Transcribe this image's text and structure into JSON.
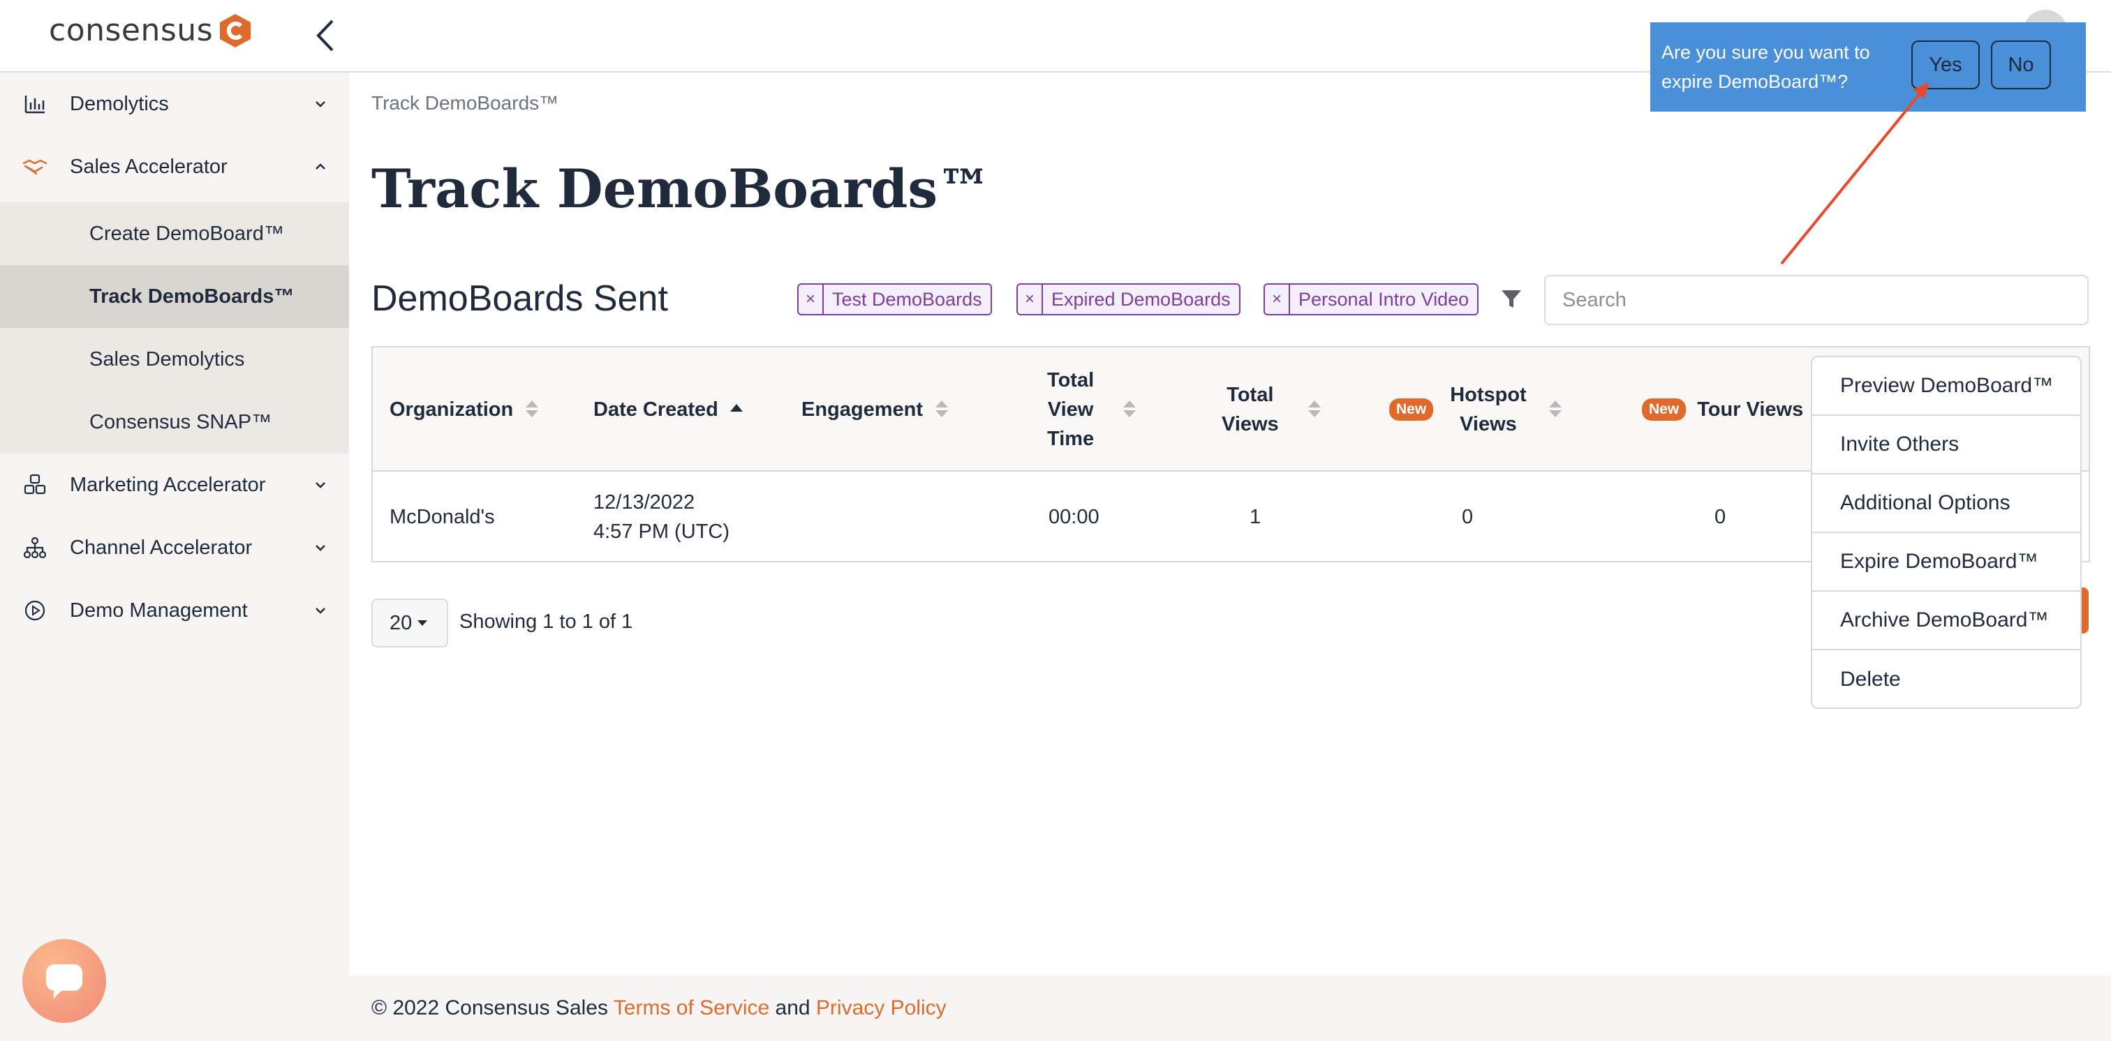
{
  "app": {
    "logo_text": "consensus",
    "brand_color": "#e06a2c"
  },
  "sidebar": {
    "items": [
      {
        "label": "Demolytics",
        "icon": "bar-chart-icon"
      },
      {
        "label": "Sales Accelerator",
        "icon": "handshake-icon"
      },
      {
        "label": "Marketing Accelerator",
        "icon": "cubes-icon"
      },
      {
        "label": "Channel Accelerator",
        "icon": "network-icon"
      },
      {
        "label": "Demo Management",
        "icon": "play-circle-icon"
      }
    ],
    "sub_items": [
      {
        "label": "Create DemoBoard™"
      },
      {
        "label": "Track DemoBoards™",
        "active": true
      },
      {
        "label": "Sales Demolytics"
      },
      {
        "label": "Consensus SNAP™"
      }
    ]
  },
  "main": {
    "breadcrumb": "Track DemoBoards™",
    "title": "Track DemoBoards™",
    "section_title": "DemoBoards Sent",
    "filters": [
      "Test DemoBoards",
      "Expired DemoBoards",
      "Personal Intro Video"
    ],
    "search": {
      "placeholder": "Search",
      "value": ""
    }
  },
  "table": {
    "columns": {
      "organization": "Organization",
      "date_created": "Date Created",
      "engagement": "Engagement",
      "total_view_time": "Total View Time",
      "total_view_time_lines": [
        "Total",
        "View",
        "Time"
      ],
      "total_views_lines": [
        "Total",
        "Views"
      ],
      "hotspot_views_lines": [
        "Hotspot",
        "Views"
      ],
      "tour_views": "Tour Views",
      "new_badge": "New"
    },
    "rows": [
      {
        "organization": "McDonald's",
        "date": "12/13/2022",
        "time": "4:57 PM (UTC)",
        "engagement": "",
        "total_view_time": "00:00",
        "total_views": "1",
        "hotspot_views": "0",
        "tour_views": "0"
      }
    ]
  },
  "pager": {
    "page_size": "20",
    "showing": "Showing 1 to 1 of 1"
  },
  "menu": {
    "items": [
      "Preview DemoBoard™",
      "Invite Others",
      "Additional Options",
      "Expire DemoBoard™",
      "Archive DemoBoard™",
      "Delete"
    ]
  },
  "confirm": {
    "message": "Are you sure you want to expire DemoBoard™?",
    "yes": "Yes",
    "no": "No",
    "bg_color": "#4a90d9"
  },
  "footer": {
    "copyright": "© 2022 Consensus Sales",
    "terms": "Terms of Service",
    "and": "and",
    "privacy": "Privacy Policy"
  }
}
